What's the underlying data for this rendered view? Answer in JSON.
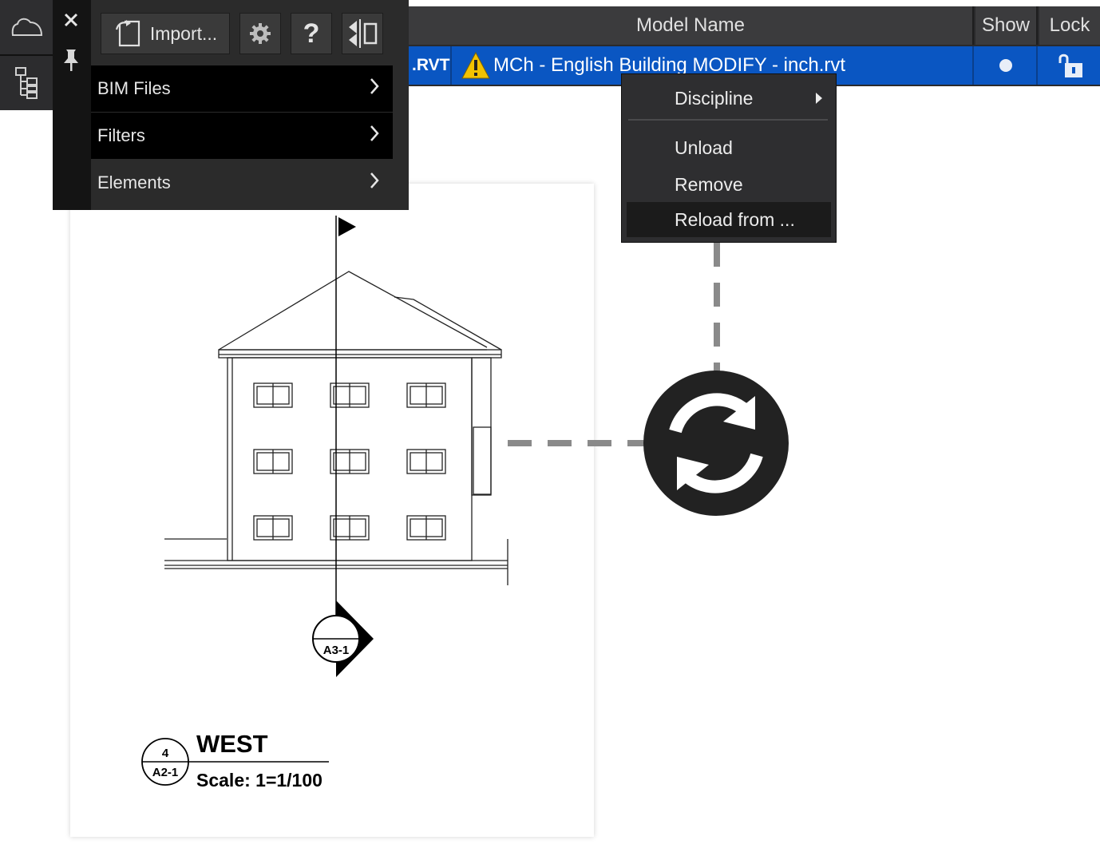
{
  "rail": {
    "top_icon": "cloud-icon",
    "bottom_icon": "tree-structure-icon"
  },
  "panel": {
    "side_icons": [
      "close-icon",
      "pin-icon"
    ],
    "toolbar": {
      "import_label": "Import...",
      "settings_icon": "gear-icon",
      "help_label": "?",
      "collapse_icon": "panel-collapse-icon"
    },
    "menu": [
      {
        "label": "BIM Files"
      },
      {
        "label": "Filters"
      },
      {
        "label": "Elements"
      }
    ]
  },
  "table": {
    "headers": {
      "model_name": "Model Name",
      "show": "Show",
      "lock": "Lock"
    },
    "row": {
      "ext": ".RVT",
      "name": "MCh - English Building MODIFY - inch.rvt",
      "warning_icon": "warning-icon",
      "show_icon": "dot-icon",
      "lock_icon": "unlock-icon"
    }
  },
  "context_menu": {
    "items": [
      {
        "label": "Discipline"
      },
      {
        "label": "Unload"
      },
      {
        "label": "Remove"
      },
      {
        "label": "Reload from ..."
      }
    ]
  },
  "drawing": {
    "section_tag_bottom": "A3-1",
    "title": "WEST",
    "scale": "Scale: 1=1/100",
    "view_number": "4",
    "sheet_ref": "A2-1"
  },
  "reload_badge_icon": "sync-icon",
  "colors": {
    "selection": "#0a56c2",
    "panel_dark": "#2b2b2b",
    "badge": "#222222",
    "warning": "#f2c200"
  }
}
